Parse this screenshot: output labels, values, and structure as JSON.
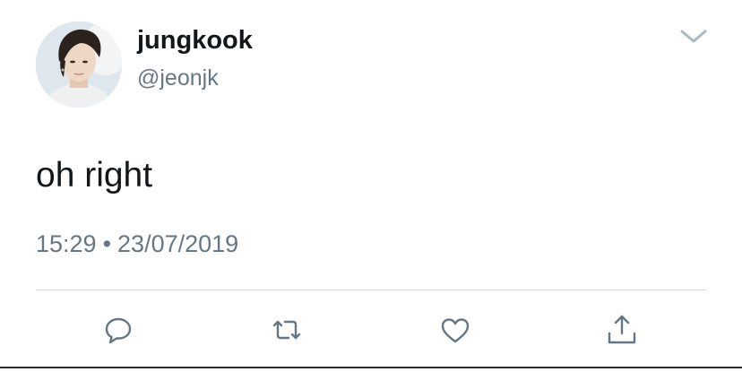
{
  "tweet": {
    "author": {
      "display_name": "jungkook",
      "handle": "@jeonjk"
    },
    "text": "oh right",
    "time": "15:29",
    "separator": "•",
    "date": "23/07/2019"
  },
  "icons": {
    "menu": "chevron-down-icon",
    "reply": "reply-icon",
    "retweet": "retweet-icon",
    "like": "heart-icon",
    "share": "share-icon"
  },
  "colors": {
    "text_primary": "#14171a",
    "text_secondary": "#657786",
    "icon": "#657786",
    "divider": "#d6dadd",
    "background": "#ffffff"
  }
}
